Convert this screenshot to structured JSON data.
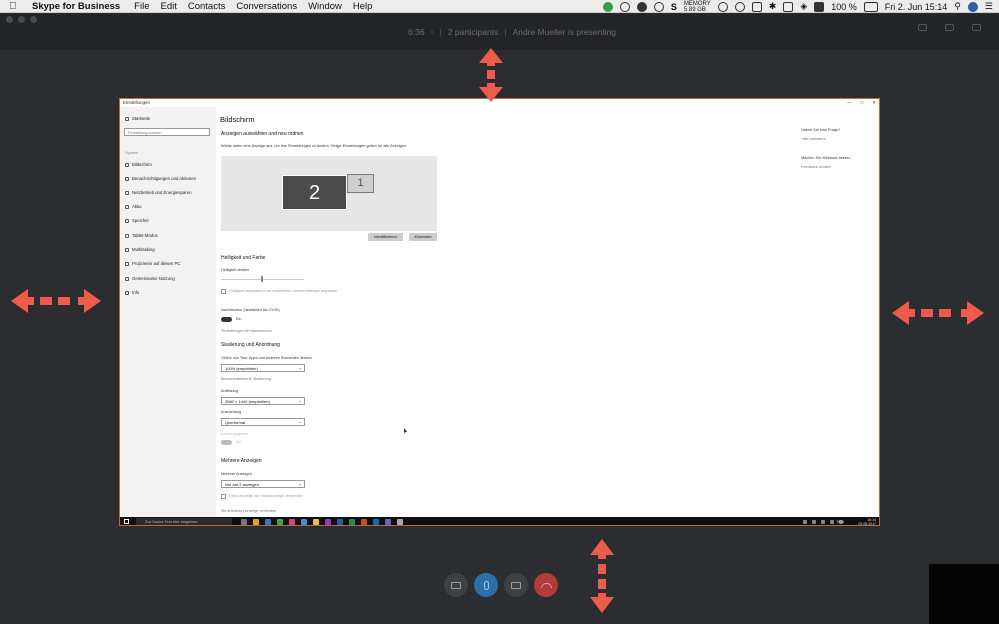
{
  "menubar": {
    "app_name": "Skype for Business",
    "menus": [
      "File",
      "Edit",
      "Contacts",
      "Conversations",
      "Window",
      "Help"
    ],
    "memory_label": "MEMORY",
    "memory_value": "5.89 GB",
    "battery": "100 %",
    "datetime": "Fri 2. Jun  15:14"
  },
  "call": {
    "duration": "6:36",
    "participants": "2 participants",
    "presenter": "Andre Mueller is presenting"
  },
  "shared_screen": {
    "window_title": "Einstellungen",
    "sidebar": {
      "home": "Startseite",
      "search_placeholder": "Einstellung suchen",
      "group": "System",
      "items": [
        "Bildschirm",
        "Benachrichtigungen und Aktionen",
        "Netzbetrieb und Energiesparen",
        "Akku",
        "Speicher",
        "Tablet-Modus",
        "Multitasking",
        "Projizieren auf diesen PC",
        "Gemeinsame Nutzung",
        "Info"
      ]
    },
    "main": {
      "title": "Bildschirm",
      "section1": "Anzeigen auswählen und neu ordnen",
      "section1_desc": "Wähle unten eine Anzeige aus, um ihre Einstellungen zu ändern. Einige Einstellungen gelten für alle Anzeigen.",
      "monitor_2": "2",
      "monitor_1": "1",
      "identify_button": "Identifizieren",
      "detect_button": "Erkennen",
      "section2": "Helligkeit und Farbe",
      "brightness_label": "Helligkeit ändern",
      "auto_brightness": "Helligkeit automatisch an veränderte Lichtverhältnisse anpassen",
      "night_mode": "Nachtmodus (deaktiviert bis 21:05)",
      "night_mode_state": "Ein",
      "night_mode_link": "Einstellungen für Nachtmodus",
      "section3": "Skalierung und Anordnung",
      "scale_label": "Größe von Text, Apps und anderen Elementen ändern",
      "scale_value": "100% (empfohlen)",
      "custom_scale_link": "Benutzerdefinierte Skalierung",
      "resolution_label": "Auflösung",
      "resolution_value": "2560 × 1440 (empfohlen)",
      "orientation_label": "Ausrichtung",
      "orientation_value": "Querformat",
      "rotation_lock": "Drehungssperre",
      "rotation_lock_state": "Ein",
      "section4": "Mehrere Anzeigen",
      "multi_label": "Mehrere Anzeigen",
      "multi_value": "Nur auf 2 anzeigen",
      "main_display": "Diese Anzeige als Hauptanzeige verwenden",
      "wireless_link": "Mit drahtloser Anzeige verbinden"
    },
    "right_panel": {
      "q_title": "Haben Sie eine Frage?",
      "q_link": "Hilfe anfordern",
      "f_title": "Machen Sie Windows besser.",
      "f_link": "Feedback senden"
    },
    "taskbar": {
      "search_placeholder": "Zur Suche Text hier eingeben",
      "time": "15:14",
      "date": "02.06.2017",
      "lang": "DEU"
    }
  },
  "colors": {
    "arrow": "#ef5b4a",
    "background": "#2b2d31",
    "share_border": "#c46a2a"
  }
}
